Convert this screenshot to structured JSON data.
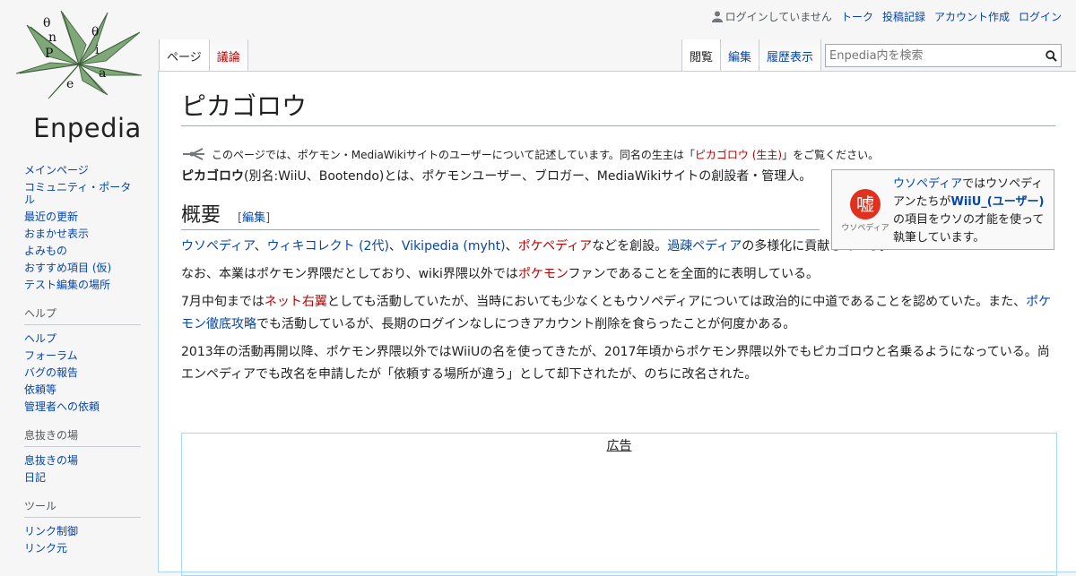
{
  "logo": {
    "text": "Enpedia"
  },
  "personal": {
    "status": "ログインしていません",
    "links": [
      "トーク",
      "投稿記録",
      "アカウント作成",
      "ログイン"
    ]
  },
  "tabs": {
    "left": [
      "ページ",
      "議論"
    ],
    "right": [
      "閲覧",
      "編集",
      "履歴表示"
    ]
  },
  "search": {
    "placeholder": "Enpedia内を検索"
  },
  "sidebar": {
    "nav": [
      "メインページ",
      "コミュニティ・ポータル",
      "最近の更新",
      "おまかせ表示",
      "よみもの",
      "おすすめ項目 (仮)",
      "テスト編集の場所"
    ],
    "help": {
      "title": "ヘルプ",
      "items": [
        "ヘルプ",
        "フォーラム",
        "バグの報告",
        "依頼等",
        "管理者への依頼"
      ]
    },
    "rest": {
      "title": "息抜きの場",
      "items": [
        "息抜きの場",
        "日記"
      ]
    },
    "tools": {
      "title": "ツール",
      "items": [
        "リンク制御",
        "リンク元"
      ]
    }
  },
  "article": {
    "title": "ピカゴロウ",
    "hatnote": {
      "pre": "このページでは、ポケモン・MediaWikiサイトのユーザーについて記述しています。同名の生主は「",
      "link": "ピカゴロウ (生主)",
      "post": "」をご覧ください。"
    },
    "intro": {
      "bold": "ピカゴロウ",
      "rest": "(別名:WiiU、Bootendo)とは、ポケモンユーザー、ブロガー、MediaWikiサイトの創設者・管理人。"
    },
    "box": {
      "icon_label": "ウソペディア",
      "link1": "ウソペディア",
      "t1": "ではウソペディアンたちが",
      "link2": "WiiU_(ユーザー)",
      "t2": "の項目をウソの才能を使って執筆しています。"
    },
    "section": {
      "heading": "概要",
      "edit": "編集"
    },
    "p1": {
      "l1": "ウソペディア",
      "s1": "、",
      "l2": "ウィキコレクト (2代)",
      "s2": "、",
      "l3": "Vikipedia (myht)",
      "s3": "、",
      "l4": "ポケペディア",
      "s4": "などを創設。",
      "l5": "過疎ペディア",
      "s5": "の多様化に貢献している。"
    },
    "p2": {
      "a": "なお、本業はポケモン界隈だとしており、wiki界隈以外では",
      "link": "ポケモン",
      "b": "ファンであることを全面的に表明している。"
    },
    "p3": {
      "a": "7月中旬までは",
      "link1": "ネット右翼",
      "b": "としても活動していたが、当時においても少なくともウソペディアについては政治的に中道であることを認めていた。また、",
      "link2": "ポケモン徹底攻略",
      "c": "でも活動しているが、長期のログインなしにつきアカウント削除を食らったことが何度かある。"
    },
    "p4": "2013年の活動再開以降、ポケモン界隈以外ではWiiUの名を使ってきたが、2017年頃からポケモン界隈以外でもピカゴロウと名乗るようになっている。尚エンペディアでも改名を申請したが「依頼する場所が違う」として却下されたが、のちに改名された。",
    "ad_label": "広告"
  }
}
